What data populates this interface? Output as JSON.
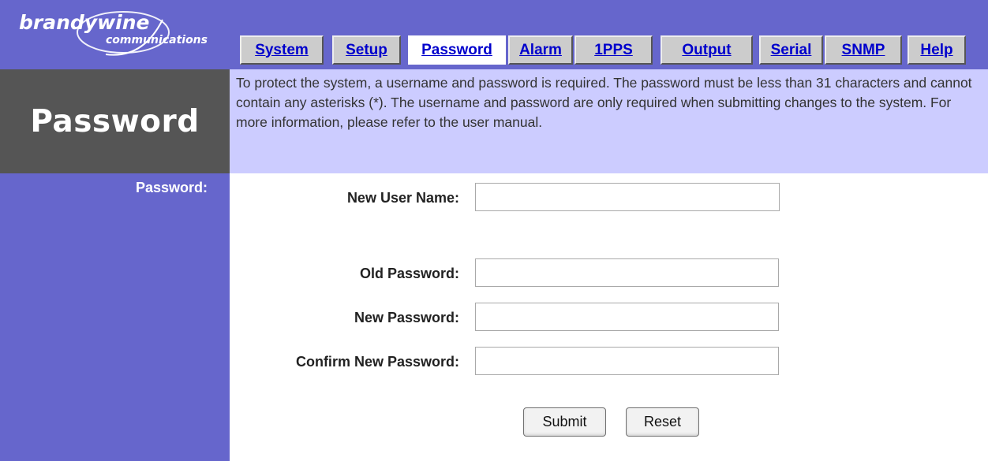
{
  "brand": {
    "name": "brandywine",
    "subname": "communications"
  },
  "nav": {
    "tabs": [
      {
        "label": "System"
      },
      {
        "label": "Setup"
      },
      {
        "label": "Password"
      },
      {
        "label": "Alarm"
      },
      {
        "label": "1PPS"
      },
      {
        "label": "Output"
      },
      {
        "label": "Serial"
      },
      {
        "label": "SNMP"
      },
      {
        "label": "Help"
      }
    ],
    "active": "Password"
  },
  "page": {
    "title": "Password",
    "description": "To protect the system, a username and password is required. The password must be less than 31 characters and cannot contain any asterisks (*). The username and password are only required when submitting changes to the system. For more information, please refer to the user manual."
  },
  "sidebar": {
    "section_label": "Password:"
  },
  "form": {
    "new_user_name": {
      "label": "New User Name:",
      "value": ""
    },
    "old_password": {
      "label": "Old Password:",
      "value": ""
    },
    "new_password": {
      "label": "New Password:",
      "value": ""
    },
    "confirm_password": {
      "label": "Confirm New Password:",
      "value": ""
    },
    "submit_label": "Submit",
    "reset_label": "Reset"
  },
  "colors": {
    "header_bg": "#6666cc",
    "title_bg": "#555555",
    "description_bg": "#ccccff",
    "tab_bg": "#cccccc",
    "link": "#0000cc"
  }
}
